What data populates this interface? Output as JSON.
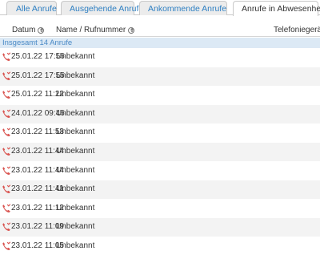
{
  "tabs": [
    {
      "label": "Alle Anrufe",
      "icon": "none",
      "active": false
    },
    {
      "label": "Ausgehende Anrufe",
      "icon": "phone-outgoing-icon",
      "active": false
    },
    {
      "label": "Ankommende Anrufe",
      "icon": "phone-incoming-icon",
      "active": false
    },
    {
      "label": "Anrufe in Abwesenheit",
      "icon": "phone-missed-icon",
      "active": true
    }
  ],
  "table": {
    "columns": {
      "date": "Datum",
      "name": "Name / Rufnummer",
      "device": "Telefoniegerät"
    },
    "total": "Insgesamt 14 Anrufe",
    "rows": [
      {
        "date": "25.01.22 17:56",
        "name": "Unbekannt"
      },
      {
        "date": "25.01.22 17:55",
        "name": "Unbekannt"
      },
      {
        "date": "25.01.22 11:22",
        "name": "Unbekannt"
      },
      {
        "date": "24.01.22 09:46",
        "name": "Unbekannt"
      },
      {
        "date": "23.01.22 11:53",
        "name": "Unbekannt"
      },
      {
        "date": "23.01.22 11:44",
        "name": "Unbekannt"
      },
      {
        "date": "23.01.22 11:44",
        "name": "Unbekannt"
      },
      {
        "date": "23.01.22 11:41",
        "name": "Unbekannt"
      },
      {
        "date": "23.01.22 11:12",
        "name": "Unbekannt"
      },
      {
        "date": "23.01.22 11:09",
        "name": "Unbekannt"
      },
      {
        "date": "23.01.22 11:05",
        "name": "Unbekannt"
      }
    ]
  },
  "colors": {
    "missed": "#d9534f",
    "outgoing": "#5cb85c",
    "incoming": "#2e7fc2",
    "link": "#2e7fc2",
    "total_bg": "#dce9f5"
  }
}
